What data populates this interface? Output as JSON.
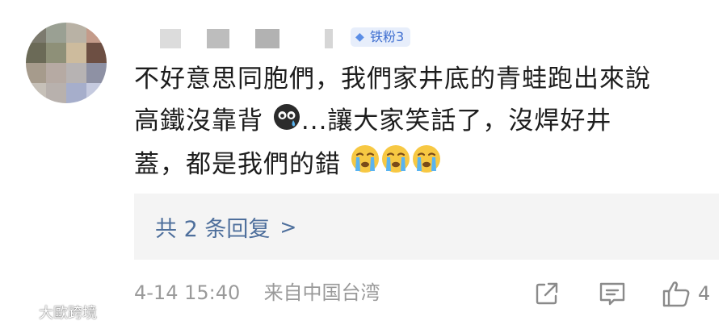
{
  "comment": {
    "user_badge": "铁粉3",
    "lines": [
      "不好意思同胞們，我們家井底的青蛙跑出來說",
      "高鐵沒靠背",
      "...讓大家笑話了，沒焊好井",
      "蓋，都是我們的錯"
    ],
    "emojis": [
      "sweat-cry-emoji",
      "crying-emoji",
      "crying-emoji",
      "crying-emoji"
    ]
  },
  "replies": {
    "label": "共 2 条回复",
    "arrow": ">"
  },
  "meta": {
    "date": "4-14",
    "time": "15:40",
    "source": "来自中国台湾"
  },
  "actions": {
    "like_count": "4"
  },
  "watermark": {
    "text": "大歐跨境"
  },
  "colors": {
    "text": "#1d1d1d",
    "link": "#4e6f9c",
    "meta": "#9a9a9a",
    "badge_bg": "#e7eefb",
    "badge_text": "#3f6fd0",
    "replies_bg": "#f4f4f4"
  }
}
